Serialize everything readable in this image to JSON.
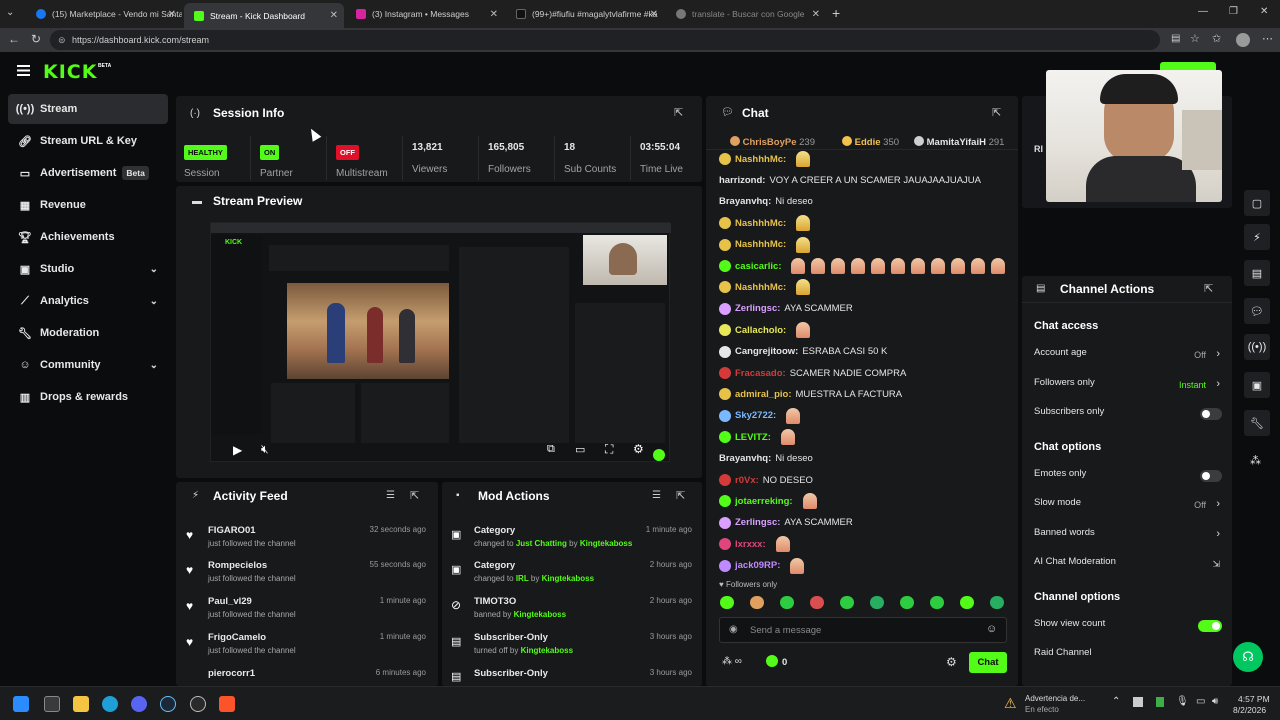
{
  "browser": {
    "tabs": [
      {
        "title": "(15) Marketplace - Vendo mi Santa",
        "color": "#1877f2"
      },
      {
        "title": "Stream - Kick Dashboard",
        "color": "#53fc18"
      },
      {
        "title": "(3) Instagram • Messages",
        "color": "#d6249f"
      },
      {
        "title": "(99+)#fiufiu #magalytvlafirme #ka",
        "color": "#111111"
      },
      {
        "title": "translate - Buscar con Google",
        "color": "#888888"
      }
    ],
    "url": "https://dashboard.kick.com/stream"
  },
  "brand": {
    "logo": "KICK",
    "beta": "BETA",
    "accent": "#53fc18"
  },
  "sidebar": {
    "items": [
      {
        "label": "Stream",
        "icon": "broadcast-icon"
      },
      {
        "label": "Stream URL & Key",
        "icon": "link-icon"
      },
      {
        "label": "Advertisement",
        "icon": "ad-icon",
        "badge": "Beta"
      },
      {
        "label": "Revenue",
        "icon": "revenue-icon"
      },
      {
        "label": "Achievements",
        "icon": "trophy-icon"
      },
      {
        "label": "Studio",
        "icon": "studio-icon"
      },
      {
        "label": "Analytics",
        "icon": "analytics-icon"
      },
      {
        "label": "Moderation",
        "icon": "wrench-icon"
      },
      {
        "label": "Community",
        "icon": "community-icon"
      },
      {
        "label": "Drops & rewards",
        "icon": "gift-icon"
      }
    ]
  },
  "session": {
    "title": "Session Info",
    "status_health": "HEALTHY",
    "status_partner": "ON",
    "status_multistream": "OFF",
    "labels": {
      "session": "Session",
      "partner": "Partner",
      "multistream": "Multistream",
      "viewers": "Viewers",
      "followers": "Followers",
      "subs": "Sub Counts",
      "time": "Time Live"
    },
    "viewers": "13,821",
    "followers": "165,805",
    "subs": "18",
    "time_live": "03:55:04"
  },
  "preview": {
    "title": "Stream Preview"
  },
  "activity": {
    "title": "Activity Feed",
    "items": [
      {
        "name": "FIGARO01",
        "sub": "just followed the channel",
        "time": "32 seconds ago"
      },
      {
        "name": "Rompecielos",
        "sub": "just followed the channel",
        "time": "55 seconds ago"
      },
      {
        "name": "Paul_vl29",
        "sub": "just followed the channel",
        "time": "1 minute ago"
      },
      {
        "name": "FrigoCamelo",
        "sub": "just followed the channel",
        "time": "1 minute ago"
      },
      {
        "name": "pierocorr1",
        "sub": "",
        "time": "6 minutes ago"
      }
    ]
  },
  "mod": {
    "title": "Mod Actions",
    "items": [
      {
        "name": "Category",
        "pre": "changed to ",
        "hl": "Just Chatting",
        "mid": " by ",
        "by": "Kingtekaboss",
        "time": "1 minute ago"
      },
      {
        "name": "Category",
        "pre": "changed to ",
        "hl": "IRL",
        "mid": " by ",
        "by": "Kingtekaboss",
        "time": "2 hours ago"
      },
      {
        "name": "TIMOT3O",
        "pre": "banned by ",
        "hl": "",
        "mid": "",
        "by": "Kingtekaboss",
        "time": "2 hours ago"
      },
      {
        "name": "Subscriber-Only",
        "pre": "turned off by ",
        "hl": "",
        "mid": "",
        "by": "Kingtekaboss",
        "time": "3 hours ago"
      },
      {
        "name": "Subscriber-Only",
        "pre": "",
        "hl": "",
        "mid": "",
        "by": "",
        "time": "3 hours ago"
      }
    ]
  },
  "chat": {
    "title": "Chat",
    "top_gifters": [
      {
        "name": "ChrisBoyPe",
        "count": "239",
        "color": "#e0a060"
      },
      {
        "name": "Eddie",
        "count": "350",
        "color": "#f2c14e"
      },
      {
        "name": "MamitaYifaiH",
        "count": "291",
        "color": "#d0d0d0"
      }
    ],
    "messages": [
      {
        "user": "NashhhMc:",
        "color": "#e7c24a",
        "text": "",
        "emotes": 1,
        "emote_type": "y"
      },
      {
        "user": "harrizond:",
        "color": "#e6e6e6",
        "text": "VOY A CREER A UN SCAMER JAUAJAAJUAJUA",
        "emotes": 0
      },
      {
        "user": "Brayanvhq:",
        "color": "#e6e6e6",
        "text": "Ni deseo",
        "emotes": 0
      },
      {
        "user": "NashhhMc:",
        "color": "#e7c24a",
        "text": "",
        "emotes": 1,
        "emote_type": "y"
      },
      {
        "user": "NashhhMc:",
        "color": "#e7c24a",
        "text": "",
        "emotes": 1,
        "emote_type": "y"
      },
      {
        "user": "casicarlic:",
        "color": "#53fc18",
        "text": "",
        "emotes": 11
      },
      {
        "user": "NashhhMc:",
        "color": "#e7c24a",
        "text": "",
        "emotes": 1,
        "emote_type": "y"
      },
      {
        "user": "Zerlingsc:",
        "color": "#d9a0ff",
        "text": "AYA SCAMMER",
        "emotes": 0
      },
      {
        "user": "Callacholo:",
        "color": "#e6e85a",
        "text": "",
        "emotes": 1
      },
      {
        "user": "Cangrejitoow:",
        "color": "#e6e6e6",
        "text": "ESRABA CASI 50 K",
        "emotes": 0
      },
      {
        "user": "Fracasado:",
        "color": "#d43a3a",
        "text": "SCAMER NADIE COMPRA",
        "emotes": 0
      },
      {
        "user": "admiral_pio:",
        "color": "#e7c24a",
        "text": "MUESTRA LA FACTURA",
        "emotes": 0
      },
      {
        "user": "Sky2722:",
        "color": "#7ab8ff",
        "text": "",
        "emotes": 1
      },
      {
        "user": "LEVITZ:",
        "color": "#53fc18",
        "text": "",
        "emotes": 1
      },
      {
        "user": "Brayanvhq:",
        "color": "#e6e6e6",
        "text": "Ni deseo",
        "emotes": 0
      },
      {
        "user": "r0Vx:",
        "color": "#d43a3a",
        "text": "NO DESEO",
        "emotes": 0
      },
      {
        "user": "jotaerreking:",
        "color": "#53fc18",
        "text": "",
        "emotes": 1
      },
      {
        "user": "Zerlingsc:",
        "color": "#d9a0ff",
        "text": "AYA SCAMMER",
        "emotes": 0
      },
      {
        "user": "lxrxxx:",
        "color": "#e0457b",
        "text": "",
        "emotes": 1
      },
      {
        "user": "jack09RP:",
        "color": "#c08aff",
        "text": "",
        "emotes": 1
      }
    ],
    "followers_only": "Followers only",
    "placeholder": "Send a message",
    "infinity": "∞",
    "points": "0",
    "send_label": "Chat"
  },
  "channel_actions": {
    "title": "Channel Actions",
    "chat_access": "Chat access",
    "account_age": {
      "label": "Account age",
      "value": "Off"
    },
    "followers_only": {
      "label": "Followers only",
      "value": "Instant"
    },
    "subscribers_only": {
      "label": "Subscribers only",
      "on": false
    },
    "chat_options": "Chat options",
    "emotes_only": {
      "label": "Emotes only",
      "on": false
    },
    "slow_mode": {
      "label": "Slow mode",
      "value": "Off"
    },
    "banned_words": {
      "label": "Banned words"
    },
    "ai_moderation": {
      "label": "AI Chat Moderation"
    },
    "channel_options": "Channel options",
    "show_view_count": {
      "label": "Show view count",
      "on": true
    },
    "raid": {
      "label": "Raid Channel"
    }
  },
  "taskbar": {
    "warning_title": "Advertencia de...",
    "warning_sub": "En efecto",
    "time": "4:57 PM",
    "date": "8/2/2026"
  }
}
